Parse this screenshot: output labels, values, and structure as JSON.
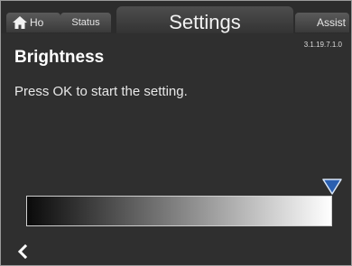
{
  "topbar": {
    "home_tab": "Ho",
    "status_tab": "Status",
    "title": "Settings",
    "assist_tab": "Assist",
    "version": "3.1.19.7.1.0"
  },
  "content": {
    "heading": "Brightness",
    "instruction": "Press OK to start the setting."
  },
  "brightness": {
    "level": 1.0,
    "marker_color": "#2a5fb0"
  },
  "icons": {
    "home": "home-icon",
    "back": "back-arrow-icon",
    "marker": "level-marker-icon"
  }
}
